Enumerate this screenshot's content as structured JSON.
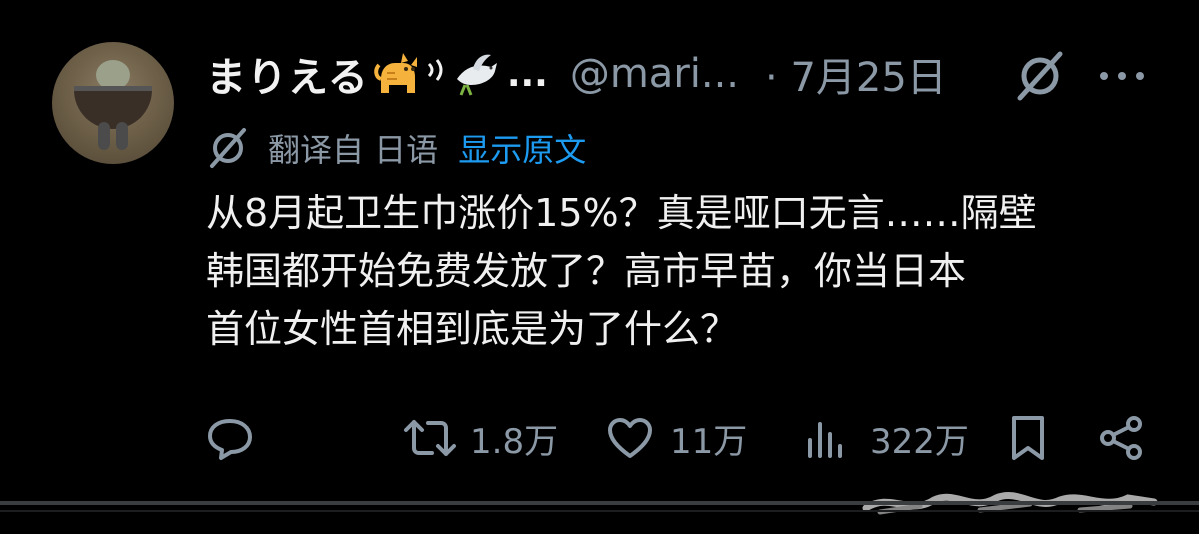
{
  "post": {
    "display_name": "まりえる",
    "name_ellipsis": "...",
    "handle": "@mari...",
    "date": "· 7月25日",
    "translation": {
      "translated_from": "翻译自 日语",
      "show_original": "显示原文"
    },
    "body_lines": [
      "从8月起卫生巾涨价15%？真是哑口无言……隔壁",
      "韩国都开始免费发放了？高市早苗，你当日本",
      "首位女性首相到底是为了什么？"
    ],
    "actions": {
      "retweets": "1.8万",
      "likes": "11万",
      "views": "322万"
    }
  },
  "icons": {
    "header": [
      "cat-emoji-icon",
      "sound-waves-icon",
      "dove-emoji-icon",
      "grok-icon",
      "more-icon"
    ],
    "translate": "grok-icon",
    "actions": [
      "reply-icon",
      "retweet-icon",
      "like-icon",
      "views-icon",
      "bookmark-icon",
      "share-icon"
    ]
  },
  "colors": {
    "background": "#000000",
    "text_primary": "#e7e9ea",
    "text_secondary": "#8b98a5",
    "link_blue": "#1d9bf0"
  }
}
